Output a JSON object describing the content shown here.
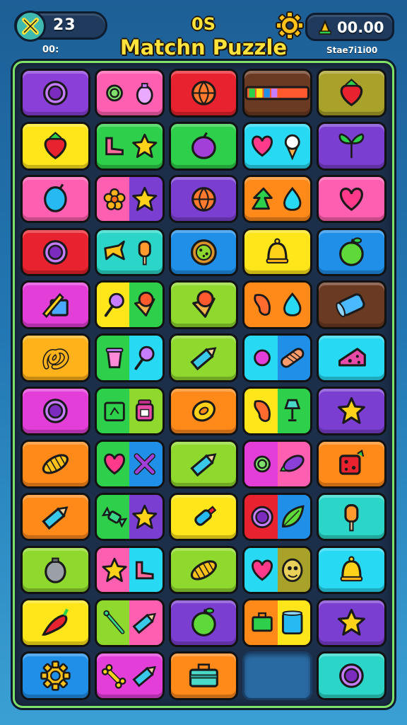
{
  "header": {
    "moves_value": "23",
    "moves_sub": "00:",
    "title_top": "0S",
    "title_main": "Matchn Puzzle",
    "score_value": "00.00",
    "score_sub": "Stae7i1i00"
  },
  "colors": {
    "purple": "#8a3fd8",
    "pink": "#ff5fb0",
    "red": "#e8222e",
    "brown": "#6b3a22",
    "olive": "#a8a12a",
    "yellow": "#ffe61a",
    "green": "#2ecf4a",
    "cyan": "#27d9f2",
    "violet": "#7a3fd0",
    "orange": "#ff8a1a",
    "blue": "#1f8fe8",
    "lime": "#8fd92e",
    "magenta": "#e33fd8",
    "amber": "#ffb21a",
    "teal": "#2bd6c8"
  },
  "board": {
    "rows": [
      [
        {
          "bg": [
            "purple"
          ],
          "icons": [
            "ring"
          ]
        },
        {
          "bg": [
            "pink"
          ],
          "icons": [
            "ring-small",
            "bulb"
          ]
        },
        {
          "bg": [
            "red"
          ],
          "icons": [
            "ball"
          ]
        },
        {
          "bg": [
            "brown"
          ],
          "icons": [
            "stripes"
          ]
        },
        {
          "bg": [
            "olive"
          ],
          "icons": [
            "strawberry"
          ]
        }
      ],
      [
        {
          "bg": [
            "yellow"
          ],
          "icons": [
            "strawberry"
          ]
        },
        {
          "bg": [
            "green"
          ],
          "icons": [
            "boot",
            "star"
          ]
        },
        {
          "bg": [
            "green"
          ],
          "icons": [
            "plum"
          ]
        },
        {
          "bg": [
            "cyan"
          ],
          "icons": [
            "heart",
            "icecream"
          ]
        },
        {
          "bg": [
            "violet"
          ],
          "icons": [
            "leaves"
          ]
        }
      ],
      [
        {
          "bg": [
            "pink"
          ],
          "icons": [
            "balloon"
          ]
        },
        {
          "bg": [
            "pink",
            "violet"
          ],
          "icons": [
            "flower",
            "star"
          ]
        },
        {
          "bg": [
            "violet"
          ],
          "icons": [
            "ball"
          ]
        },
        {
          "bg": [
            "orange"
          ],
          "icons": [
            "arrow",
            "drop"
          ]
        },
        {
          "bg": [
            "pink"
          ],
          "icons": [
            "heart"
          ]
        }
      ],
      [
        {
          "bg": [
            "red"
          ],
          "icons": [
            "ring"
          ]
        },
        {
          "bg": [
            "teal"
          ],
          "icons": [
            "bird",
            "popsicle"
          ]
        },
        {
          "bg": [
            "blue"
          ],
          "icons": [
            "cookie"
          ]
        },
        {
          "bg": [
            "yellow"
          ],
          "icons": [
            "bell"
          ]
        },
        {
          "bg": [
            "blue"
          ],
          "icons": [
            "apple"
          ]
        }
      ],
      [
        {
          "bg": [
            "magenta"
          ],
          "icons": [
            "pencil-box"
          ]
        },
        {
          "bg": [
            "yellow",
            "green"
          ],
          "icons": [
            "lollipop",
            "cone"
          ]
        },
        {
          "bg": [
            "lime"
          ],
          "icons": [
            "cone"
          ]
        },
        {
          "bg": [
            "orange",
            "orange"
          ],
          "icons": [
            "bean",
            "drop"
          ]
        },
        {
          "bg": [
            "brown"
          ],
          "icons": [
            "cylinder"
          ]
        }
      ],
      [
        {
          "bg": [
            "amber"
          ],
          "icons": [
            "pretzel"
          ]
        },
        {
          "bg": [
            "green",
            "cyan"
          ],
          "icons": [
            "cup",
            "lollipop"
          ]
        },
        {
          "bg": [
            "lime"
          ],
          "icons": [
            "pencil"
          ]
        },
        {
          "bg": [
            "cyan",
            "blue"
          ],
          "icons": [
            "dot",
            "bandage"
          ]
        },
        {
          "bg": [
            "cyan"
          ],
          "icons": [
            "cheese"
          ]
        }
      ],
      [
        {
          "bg": [
            "magenta"
          ],
          "icons": [
            "ring"
          ]
        },
        {
          "bg": [
            "green",
            "lime"
          ],
          "icons": [
            "box",
            "jar"
          ]
        },
        {
          "bg": [
            "orange"
          ],
          "icons": [
            "mango"
          ]
        },
        {
          "bg": [
            "yellow",
            "green"
          ],
          "icons": [
            "bean",
            "lamp"
          ]
        },
        {
          "bg": [
            "violet"
          ],
          "icons": [
            "star"
          ]
        }
      ],
      [
        {
          "bg": [
            "orange"
          ],
          "icons": [
            "corn"
          ]
        },
        {
          "bg": [
            "green",
            "blue"
          ],
          "icons": [
            "heart",
            "x"
          ]
        },
        {
          "bg": [
            "lime"
          ],
          "icons": [
            "pencil"
          ]
        },
        {
          "bg": [
            "magenta",
            "pink"
          ],
          "icons": [
            "ring-small",
            "eggplant"
          ]
        },
        {
          "bg": [
            "orange"
          ],
          "icons": [
            "dice"
          ]
        }
      ],
      [
        {
          "bg": [
            "orange"
          ],
          "icons": [
            "pencil"
          ]
        },
        {
          "bg": [
            "green",
            "violet"
          ],
          "icons": [
            "candy",
            "star"
          ]
        },
        {
          "bg": [
            "yellow"
          ],
          "icons": [
            "bottle"
          ]
        },
        {
          "bg": [
            "red",
            "blue"
          ],
          "icons": [
            "ring",
            "leaf"
          ]
        },
        {
          "bg": [
            "teal"
          ],
          "icons": [
            "popsicle"
          ]
        }
      ],
      [
        {
          "bg": [
            "lime"
          ],
          "icons": [
            "bag"
          ]
        },
        {
          "bg": [
            "pink",
            "cyan"
          ],
          "icons": [
            "star",
            "boot"
          ]
        },
        {
          "bg": [
            "lime"
          ],
          "icons": [
            "corn"
          ]
        },
        {
          "bg": [
            "cyan",
            "olive"
          ],
          "icons": [
            "heart",
            "coin"
          ]
        },
        {
          "bg": [
            "cyan"
          ],
          "icons": [
            "bell"
          ]
        }
      ],
      [
        {
          "bg": [
            "yellow"
          ],
          "icons": [
            "chili"
          ]
        },
        {
          "bg": [
            "lime",
            "pink"
          ],
          "icons": [
            "stick",
            "pencil"
          ]
        },
        {
          "bg": [
            "violet"
          ],
          "icons": [
            "apple"
          ]
        },
        {
          "bg": [
            "orange",
            "yellow"
          ],
          "icons": [
            "suitcase",
            "can"
          ]
        },
        {
          "bg": [
            "violet"
          ],
          "icons": [
            "star"
          ]
        }
      ],
      [
        {
          "bg": [
            "blue"
          ],
          "icons": [
            "gear"
          ]
        },
        {
          "bg": [
            "magenta"
          ],
          "icons": [
            "bone",
            "pencil"
          ]
        },
        {
          "bg": [
            "orange"
          ],
          "icons": [
            "toolbox"
          ]
        },
        {
          "bg": [],
          "icons": []
        },
        {
          "bg": [
            "teal"
          ],
          "icons": [
            "ring"
          ]
        }
      ]
    ]
  }
}
